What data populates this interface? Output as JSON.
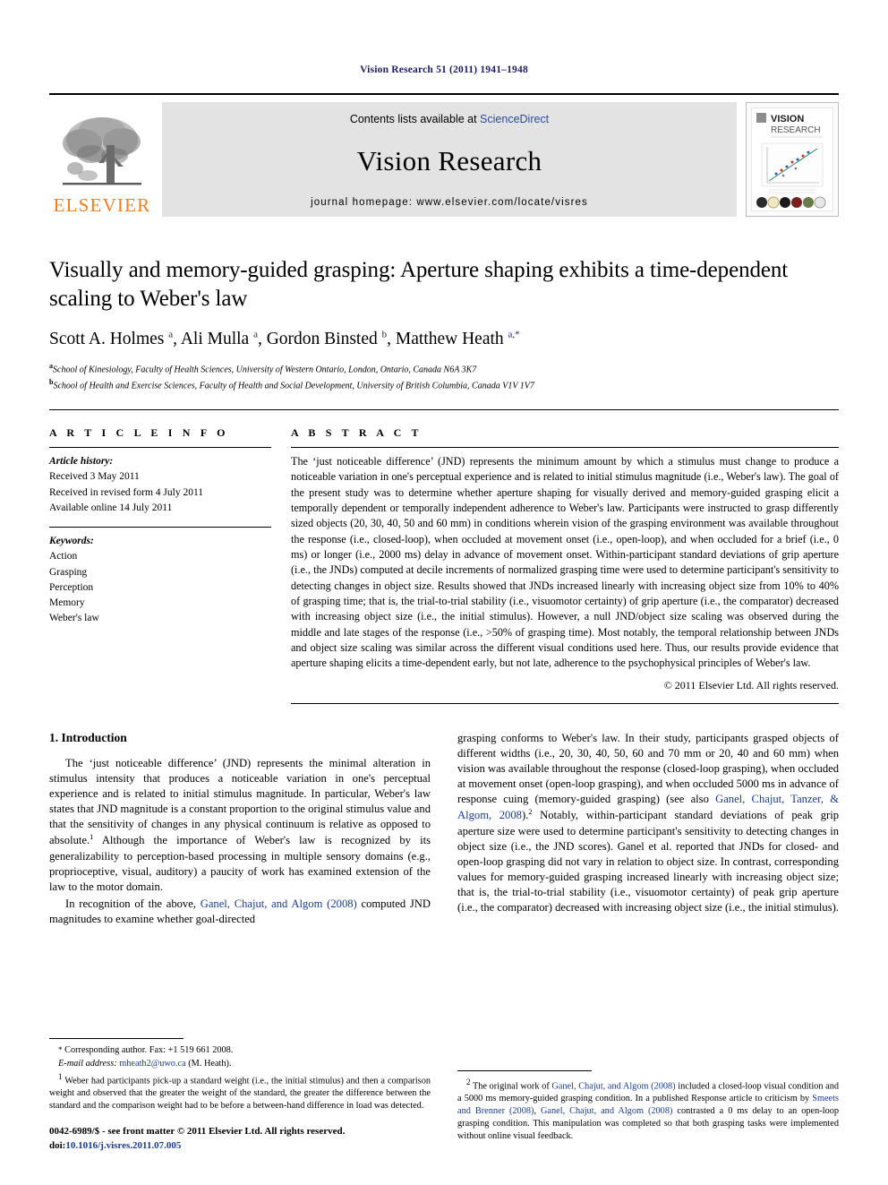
{
  "running_head": "Vision Research 51 (2011) 1941–1948",
  "banner": {
    "contents_prefix": "Contents lists available at ",
    "sciencedirect": "ScienceDirect",
    "journal_name": "Vision Research",
    "homepage": "journal homepage: www.elsevier.com/locate/visres",
    "publisher_wordmark": "ELSEVIER",
    "cover_title_line1": "VISION",
    "cover_title_line2": "RESEARCH",
    "accent_link_color": "#2a4b9b",
    "elsevier_orange": "#f57c20",
    "banner_gray": "#e3e3e3"
  },
  "title": "Visually and memory-guided grasping: Aperture shaping exhibits a time-dependent scaling to Weber's law",
  "authors_html": "Scott A. Holmes <sup>a</sup>, Ali Mulla <sup>a</sup>, Gordon Binsted <sup>b</sup>, Matthew Heath <sup>a,*</sup>",
  "affiliations": [
    {
      "marker": "a",
      "text": "School of Kinesiology, Faculty of Health Sciences, University of Western Ontario, London, Ontario, Canada N6A 3K7"
    },
    {
      "marker": "b",
      "text": "School of Health and Exercise Sciences, Faculty of Health and Social Development, University of British Columbia, Canada V1V 1V7"
    }
  ],
  "article_info": {
    "heading": "A R T I C L E  I N F O",
    "history_label": "Article history:",
    "history": [
      "Received 3 May 2011",
      "Received in revised form 4 July 2011",
      "Available online 14 July 2011"
    ],
    "keywords_label": "Keywords:",
    "keywords": [
      "Action",
      "Grasping",
      "Perception",
      "Memory",
      "Weber's law"
    ]
  },
  "abstract": {
    "heading": "A B S T R A C T",
    "text": "The ‘just noticeable difference’ (JND) represents the minimum amount by which a stimulus must change to produce a noticeable variation in one's perceptual experience and is related to initial stimulus magnitude (i.e., Weber's law). The goal of the present study was to determine whether aperture shaping for visually derived and memory-guided grasping elicit a temporally dependent or temporally independent adherence to Weber's law. Participants were instructed to grasp differently sized objects (20, 30, 40, 50 and 60 mm) in conditions wherein vision of the grasping environment was available throughout the response (i.e., closed-loop), when occluded at movement onset (i.e., open-loop), and when occluded for a brief (i.e., 0 ms) or longer (i.e., 2000 ms) delay in advance of movement onset. Within-participant standard deviations of grip aperture (i.e., the JNDs) computed at decile increments of normalized grasping time were used to determine participant's sensitivity to detecting changes in object size. Results showed that JNDs increased linearly with increasing object size from 10% to 40% of grasping time; that is, the trial-to-trial stability (i.e., visuomotor certainty) of grip aperture (i.e., the comparator) decreased with increasing object size (i.e., the initial stimulus). However, a null JND/object size scaling was observed during the middle and late stages of the response (i.e., >50% of grasping time). Most notably, the temporal relationship between JNDs and object size scaling was similar across the different visual conditions used here. Thus, our results provide evidence that aperture shaping elicits a time-dependent early, but not late, adherence to the psychophysical principles of Weber's law.",
    "copyright": "© 2011 Elsevier Ltd. All rights reserved."
  },
  "introduction": {
    "heading": "1. Introduction",
    "left_para_1_pre": "The ‘just noticeable difference’ (JND) represents the minimal alteration in stimulus intensity that produces a noticeable variation in one's perceptual experience and is related to initial stimulus magnitude. In particular, Weber's law states that JND magnitude is a constant proportion to the original stimulus value and that the sensitivity of changes in any physical continuum is relative as opposed to absolute.",
    "left_para_1_sup": "1",
    "left_para_1_post": " Although the importance of Weber's law is recognized by its generalizability to perception-based processing in multiple sensory domains (e.g., proprioceptive, visual, auditory) a paucity of work has examined extension of the law to the motor domain.",
    "left_para_2_pre": "In recognition of the above, ",
    "left_para_2_cite": "Ganel, Chajut, and Algom (2008)",
    "left_para_2_post": " computed JND magnitudes to examine whether goal-directed",
    "right_para_1_pre": "grasping conforms to Weber's law. In their study, participants grasped objects of different widths (i.e., 20, 30, 40, 50, 60 and 70 mm or 20, 40 and 60 mm) when vision was available throughout the response (closed-loop grasping), when occluded at movement onset (open-loop grasping), and when occluded 5000 ms in advance of response cuing (memory-guided grasping) (see also ",
    "right_para_1_cite": "Ganel, Chajut, Tanzer, & Algom, 2008",
    "right_para_1_mid": ").",
    "right_para_1_sup": "2",
    "right_para_1_post": " Notably, within-participant standard deviations of peak grip aperture size were used to determine participant's sensitivity to detecting changes in object size (i.e., the JND scores). Ganel et al. reported that JNDs for closed- and open-loop grasping did not vary in relation to object size. In contrast, corresponding values for memory-guided grasping increased linearly with increasing object size; that is, the trial-to-trial stability (i.e., visuomotor certainty) of peak grip aperture (i.e., the comparator) decreased with increasing object size (i.e., the initial stimulus)."
  },
  "footnotes": {
    "corresponding_marker": "*",
    "corresponding_text": "Corresponding author. Fax: +1 519 661 2008.",
    "email_label": "E-mail address:",
    "email": "mheath2@uwo.ca",
    "email_owner": "(M. Heath).",
    "fn1_marker": "1",
    "fn1_text": "Weber had participants pick-up a standard weight (i.e., the initial stimulus) and then a comparison weight and observed that the greater the weight of the standard, the greater the difference between the standard and the comparison weight had to be before a between-hand difference in load was detected.",
    "fn2_marker": "2",
    "fn2_pre": "The original work of ",
    "fn2_cite1": "Ganel, Chajut, and Algom (2008)",
    "fn2_mid1": " included a closed-loop visual condition and a 5000 ms memory-guided grasping condition. In a published Response article to criticism by ",
    "fn2_cite2": "Smeets and Brenner (2008)",
    "fn2_mid2": ", ",
    "fn2_cite3": "Ganel, Chajut, and Algom (2008)",
    "fn2_post": " contrasted a 0 ms delay to an open-loop grasping condition. This manipulation was completed so that both grasping tasks were implemented without online visual feedback."
  },
  "imprint": {
    "issn_line": "0042-6989/$ - see front matter © 2011 Elsevier Ltd. All rights reserved.",
    "doi_label": "doi:",
    "doi_value": "10.1016/j.visres.2011.07.005"
  }
}
